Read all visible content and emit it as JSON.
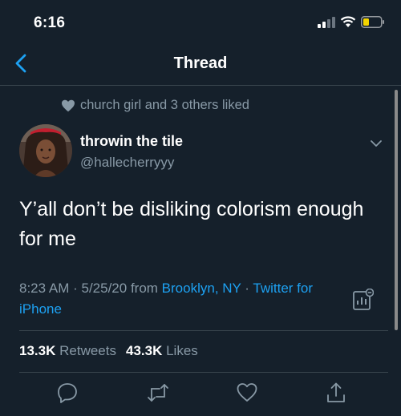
{
  "status": {
    "time": "6:16"
  },
  "nav": {
    "title": "Thread"
  },
  "social_context": {
    "text": "church girl and 3 others liked"
  },
  "tweet": {
    "author_name": "throwin the tile",
    "author_handle": "@hallecherryyy",
    "text": "Y’all don’t be disliking colorism enough for me",
    "time": "8:23 AM",
    "sep1": " · ",
    "date": "5/25/20",
    "from_label": " from ",
    "location": "Brooklyn, NY",
    "sep2": " · ",
    "source": "Twitter for iPhone"
  },
  "stats": {
    "retweets_count": "13.3K",
    "retweets_label": "Retweets",
    "likes_count": "43.3K",
    "likes_label": "Likes"
  },
  "colors": {
    "background": "#15202b",
    "secondary_text": "#8899a6",
    "accent": "#1da1f2",
    "divider": "#38444d"
  },
  "icons": [
    "back-arrow-icon",
    "heart-icon",
    "chevron-down-icon",
    "analytics-icon",
    "reply-icon",
    "retweet-icon",
    "like-icon",
    "share-icon",
    "signal-icon",
    "wifi-icon",
    "battery-icon"
  ]
}
